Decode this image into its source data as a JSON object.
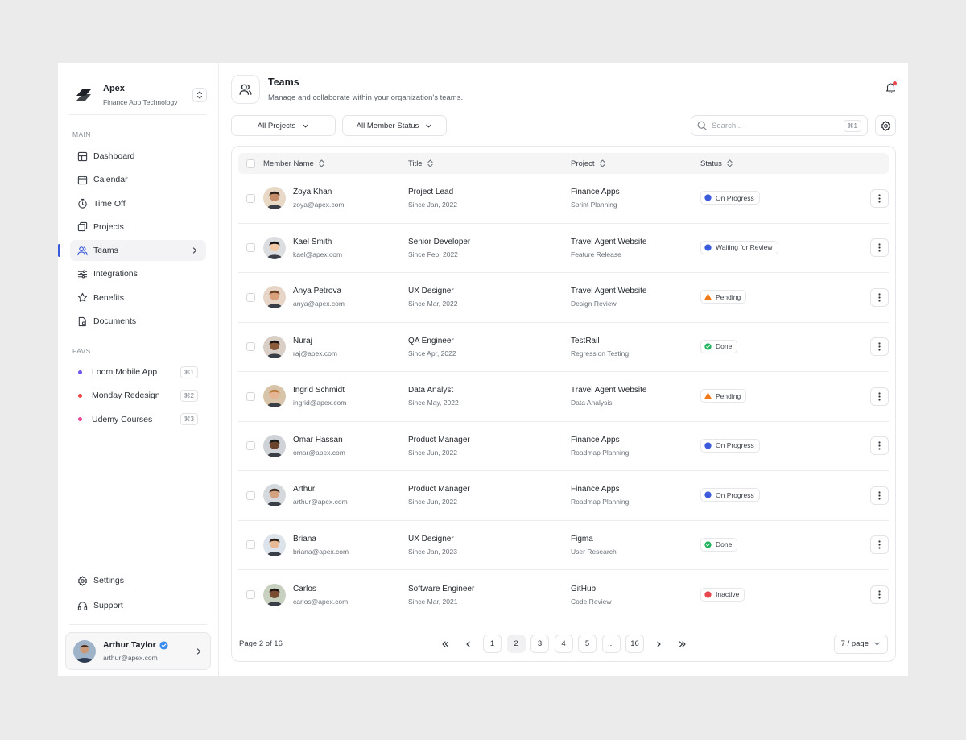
{
  "brand": {
    "name": "Apex",
    "subtitle": "Finance App Technology"
  },
  "sidebar": {
    "main_label": "MAIN",
    "items": [
      {
        "label": "Dashboard",
        "icon": "grid-icon"
      },
      {
        "label": "Calendar",
        "icon": "calendar-icon"
      },
      {
        "label": "Time Off",
        "icon": "timer-icon"
      },
      {
        "label": "Projects",
        "icon": "layers-icon"
      },
      {
        "label": "Teams",
        "icon": "users-icon",
        "active": true
      },
      {
        "label": "Integrations",
        "icon": "sliders-icon"
      },
      {
        "label": "Benefits",
        "icon": "star-icon"
      },
      {
        "label": "Documents",
        "icon": "document-icon"
      }
    ],
    "favs_label": "FAVS",
    "favs": [
      {
        "label": "Loom Mobile App",
        "color": "#6e56f2",
        "shortcut": "⌘1"
      },
      {
        "label": "Monday Redesign",
        "color": "#ef4444",
        "shortcut": "⌘2"
      },
      {
        "label": "Udemy Courses",
        "color": "#ec4899",
        "shortcut": "⌘3"
      }
    ],
    "settings_label": "Settings",
    "support_label": "Support"
  },
  "user": {
    "name": "Arthur Taylor",
    "email": "arthur@apex.com"
  },
  "header": {
    "title": "Teams",
    "subtitle": "Manage and collaborate within your organization's teams."
  },
  "filters": {
    "projects": "All Projects",
    "status": "All Member Status"
  },
  "search": {
    "placeholder": "Search...",
    "shortcut": "⌘1"
  },
  "table": {
    "columns": {
      "name": "Member Name",
      "title": "Title",
      "project": "Project",
      "status": "Status"
    },
    "rows": [
      {
        "name": "Zoya Khan",
        "email": "zoya@apex.com",
        "title": "Project Lead",
        "since": "Since Jan, 2022",
        "project": "Finance Apps",
        "project_sub": "Sprint Planning",
        "status": "On Progress",
        "status_type": "info"
      },
      {
        "name": "Kael Smith",
        "email": "kael@apex.com",
        "title": "Senior Developer",
        "since": "Since Feb, 2022",
        "project": "Travel Agent Website",
        "project_sub": "Feature Release",
        "status": "Waiting for Review",
        "status_type": "info"
      },
      {
        "name": "Anya Petrova",
        "email": "anya@apex.com",
        "title": "UX Designer",
        "since": "Since Mar, 2022",
        "project": "Travel Agent Website",
        "project_sub": "Design Review",
        "status": "Pending",
        "status_type": "warning"
      },
      {
        "name": "Nuraj",
        "email": "raj@apex.com",
        "title": "QA Engineer",
        "since": "Since Apr, 2022",
        "project": "TestRail",
        "project_sub": "Regression Testing",
        "status": "Done",
        "status_type": "success"
      },
      {
        "name": "Ingrid Schmidt",
        "email": "ingrid@apex.com",
        "title": "Data Analyst",
        "since": "Since May, 2022",
        "project": "Travel Agent Website",
        "project_sub": "Data Analysis",
        "status": "Pending",
        "status_type": "warning"
      },
      {
        "name": "Omar Hassan",
        "email": "omar@apex.com",
        "title": "Product Manager",
        "since": "Since Jun, 2022",
        "project": "Finance Apps",
        "project_sub": "Roadmap Planning",
        "status": "On Progress",
        "status_type": "info"
      },
      {
        "name": "Arthur",
        "email": "arthur@apex.com",
        "title": "Product Manager",
        "since": "Since Jun, 2022",
        "project": "Finance Apps",
        "project_sub": "Roadmap Planning",
        "status": "On Progress",
        "status_type": "info"
      },
      {
        "name": "Briana",
        "email": "briana@apex.com",
        "title": "UX Designer",
        "since": "Since Jan, 2023",
        "project": "Figma",
        "project_sub": "User Research",
        "status": "Done",
        "status_type": "success"
      },
      {
        "name": "Carlos",
        "email": "carlos@apex.com",
        "title": "Software Engineer",
        "since": "Since Mar, 2021",
        "project": "GitHub",
        "project_sub": "Code Review",
        "status": "Inactive",
        "status_type": "danger"
      }
    ]
  },
  "pagination": {
    "info": "Page 2 of 16",
    "pages": [
      "1",
      "2",
      "3",
      "4",
      "5",
      "...",
      "16"
    ],
    "current": "2",
    "per_page": "7 / page"
  },
  "colors": {
    "accent": "#3b5bdb",
    "info": "#3b5bdb",
    "warning": "#f07a1a",
    "success": "#22b35e",
    "danger": "#e5484d"
  }
}
